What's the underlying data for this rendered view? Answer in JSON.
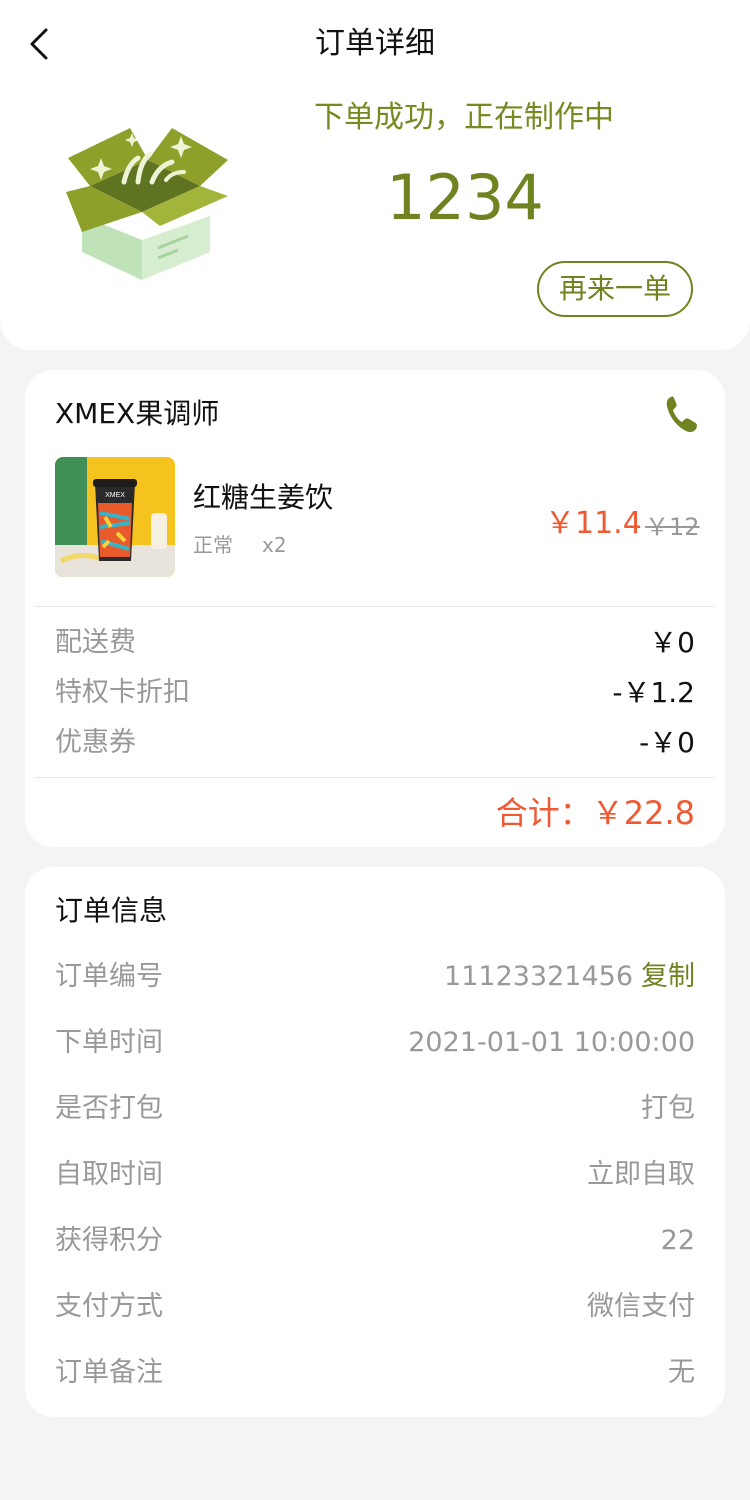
{
  "header": {
    "title": "订单详细",
    "back_icon": "chevron-left-icon"
  },
  "status": {
    "text": "下单成功，正在制作中",
    "pickup_number": "1234",
    "reorder_label": "再来一单",
    "illustration_icon": "gift-box-icon"
  },
  "order": {
    "store_name": "XMEX果调师",
    "phone_icon": "phone-icon",
    "item": {
      "name": "红糖生姜饮",
      "spec": "正常",
      "quantity": "x2",
      "price": "￥11.4",
      "original_price": "￥12"
    },
    "fees": [
      {
        "label": "配送费",
        "value": "￥0"
      },
      {
        "label": "特权卡折扣",
        "value": "-￥1.2"
      },
      {
        "label": "优惠券",
        "value": "-￥0"
      }
    ],
    "total": "合计：￥22.8"
  },
  "info": {
    "title": "订单信息",
    "order_no_label": "订单编号",
    "order_no": "11123321456",
    "copy_label": "复制",
    "rows": [
      {
        "label": "下单时间",
        "value": "2021-01-01 10:00:00"
      },
      {
        "label": "是否打包",
        "value": "打包"
      },
      {
        "label": "自取时间",
        "value": "立即自取"
      },
      {
        "label": "获得积分",
        "value": "22"
      },
      {
        "label": "支付方式",
        "value": "微信支付"
      },
      {
        "label": "订单备注",
        "value": "无"
      }
    ]
  },
  "colors": {
    "brand_green": "#6f8421",
    "price_red": "#f05a33",
    "muted_gray": "#999999"
  }
}
